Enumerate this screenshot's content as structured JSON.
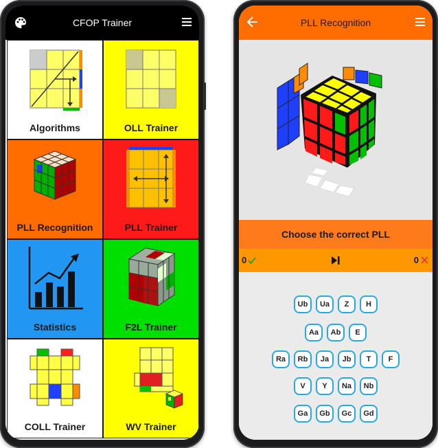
{
  "home": {
    "title": "CFOP Trainer",
    "tiles": [
      {
        "label": "Algorithms",
        "color": "#ffffff"
      },
      {
        "label": "OLL Trainer",
        "color": "#ffff00"
      },
      {
        "label": "PLL Recognition",
        "color": "#ff6d00"
      },
      {
        "label": "PLL Trainer",
        "color": "#ff1a1a"
      },
      {
        "label": "Statistics",
        "color": "#2196f3"
      },
      {
        "label": "F2L Trainer",
        "color": "#00e000"
      },
      {
        "label": "COLL Trainer",
        "color": "#ffffff"
      },
      {
        "label": "WV Trainer",
        "color": "#ffff00"
      }
    ]
  },
  "pll": {
    "title": "PLL Recognition",
    "prompt": "Choose the correct PLL",
    "correct_count": "0",
    "wrong_count": "0",
    "answer_rows": [
      [
        "Ub",
        "Ua",
        "Z",
        "H"
      ],
      [
        "Aa",
        "Ab",
        "E"
      ],
      [
        "Ra",
        "Rb",
        "Ja",
        "Jb",
        "T",
        "F"
      ],
      [
        "V",
        "Y",
        "Na",
        "Nb"
      ],
      [
        "Ga",
        "Gb",
        "Gc",
        "Gd"
      ]
    ]
  },
  "colors": {
    "accent_orange": "#ff6d00",
    "button_border": "#29a8e0",
    "correct_green": "#2e9e2e",
    "wrong_red": "#e53935"
  }
}
